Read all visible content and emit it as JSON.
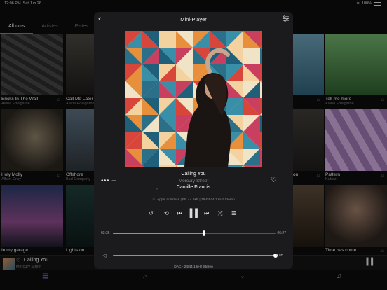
{
  "status": {
    "time": "12:06 PM",
    "date": "Sat Jun 26",
    "battery": "100%"
  },
  "library": {
    "tabs": [
      "Albums",
      "Artistes",
      "Pistes"
    ],
    "active_tab": "Albums",
    "albums": [
      {
        "title": "Bricks In The Wall",
        "artist": "Alana Edelgarde"
      },
      {
        "title": "Call Me Later",
        "artist": "Alana Edelgarde"
      },
      {
        "title": "",
        "artist": ""
      },
      {
        "title": "Tell me more",
        "artist": "Alana Edelgarde"
      },
      {
        "title": "Holy Molly",
        "artist": "Albert Gray"
      },
      {
        "title": "Offshore",
        "artist": "Bad Company"
      },
      {
        "title": "on",
        "artist": ""
      },
      {
        "title": "Pattern",
        "artist": "Kubez"
      },
      {
        "title": "In my garage",
        "artist": ""
      },
      {
        "title": "Lights on",
        "artist": ""
      },
      {
        "title": "",
        "artist": ""
      },
      {
        "title": "Time has come",
        "artist": ""
      }
    ]
  },
  "mini_bar": {
    "title": "Calling You",
    "artist": "Mercury Street"
  },
  "player": {
    "title": "Mini-Player",
    "song": "Calling You",
    "album": "Mercury Street",
    "artist": "Camille Francis",
    "format": "Apple Lossless | FR - 4.5kB | 16-bit/44.1 kHz Stereo",
    "elapsed": "03:36",
    "remaining": "06:27",
    "progress_fraction": 0.56,
    "volume": "0 dB",
    "volume_fraction": 1.0,
    "dac": "DAC - 24/44.1 kHz Stereo",
    "accent_color": "#8f82e8"
  },
  "icons": {
    "back": "chevron-left-icon",
    "settings": "sliders-icon",
    "more": "more-icon",
    "add": "plus-icon",
    "heart": "heart-icon",
    "cloud": "cloud-home-icon",
    "replay": "replay-icon",
    "repeat": "repeat-icon",
    "prev": "previous-icon",
    "pause": "pause-icon",
    "next": "next-icon",
    "shuffle": "shuffle-icon",
    "queue": "queue-icon",
    "speaker": "speaker-icon"
  }
}
